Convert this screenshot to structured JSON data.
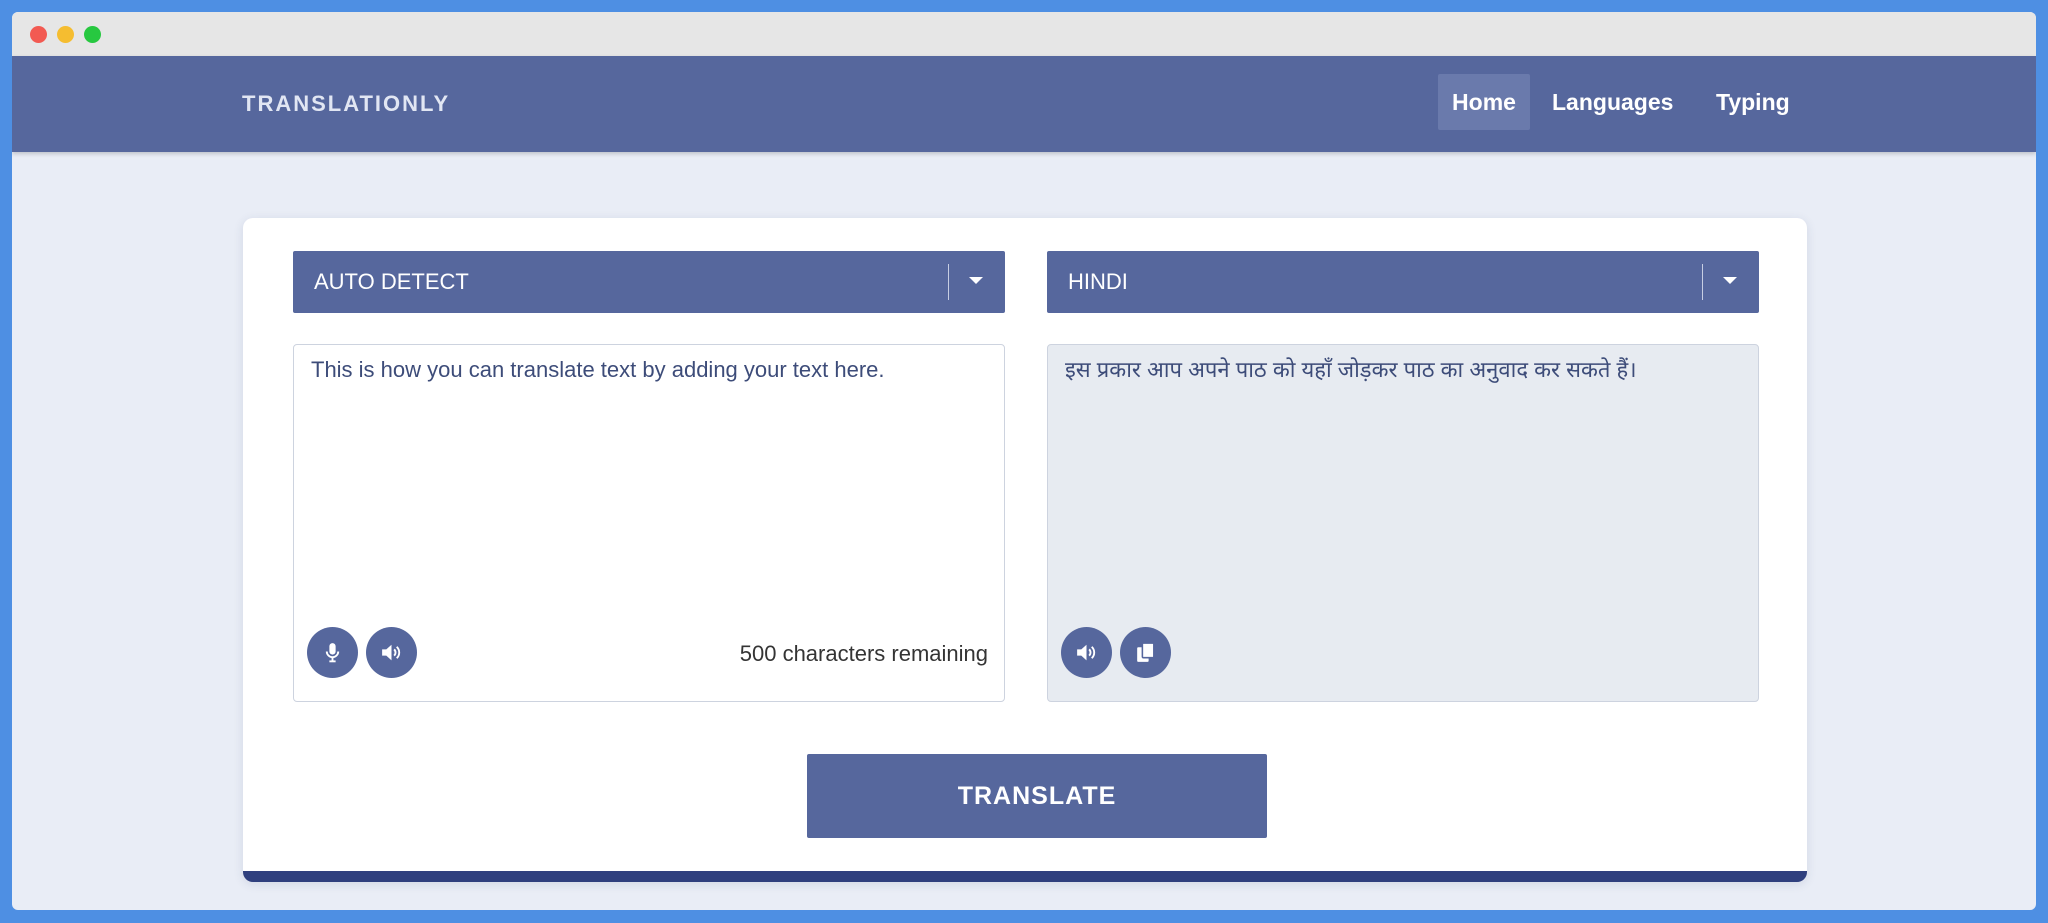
{
  "navbar": {
    "brand": "TRANSLATIONLY",
    "links": [
      {
        "label": "Home",
        "active": true
      },
      {
        "label": "Languages"
      },
      {
        "label": "Typing"
      }
    ]
  },
  "source": {
    "language": "AUTO DETECT",
    "text": "This is how you can translate text by adding your text here.",
    "remaining": "500 characters remaining",
    "buttons": [
      "microphone-icon",
      "speaker-icon"
    ]
  },
  "target": {
    "language": "HINDI",
    "text": "इस प्रकार आप अपने पाठ को यहाँ जोड़कर पाठ का अनुवाद कर सकते हैं।",
    "buttons": [
      "speaker-icon",
      "copy-icon"
    ]
  },
  "actions": {
    "translate_label": "TRANSLATE"
  },
  "colors": {
    "primary": "#56679d",
    "card_bottom": "#2f3f7e",
    "page_bg": "#e9edf6"
  }
}
